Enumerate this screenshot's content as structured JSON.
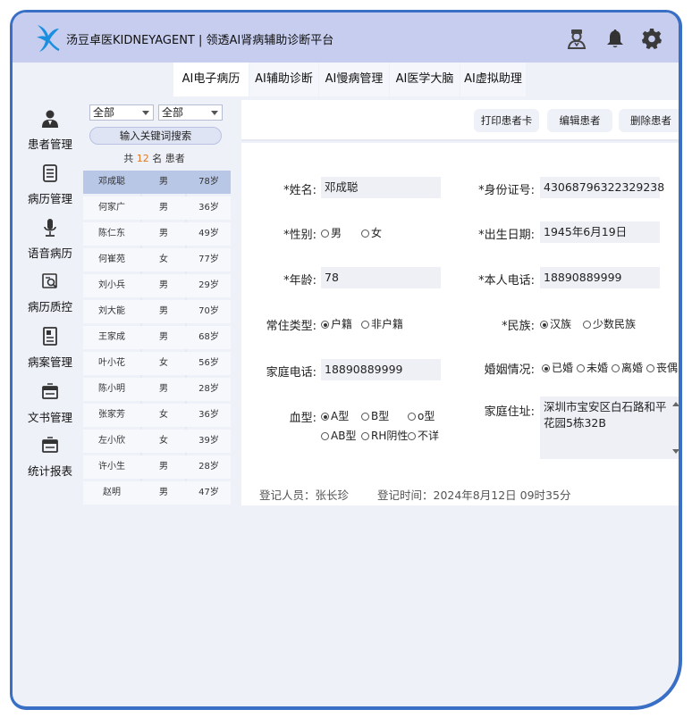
{
  "header": {
    "title": "汤豆卓医KIDNEYAGENT  |  领透AI肾病辅助诊断平台",
    "icons": [
      "doctor-icon",
      "bell-icon",
      "gear-icon"
    ]
  },
  "tabs": [
    {
      "label": "AI电子病历",
      "active": true
    },
    {
      "label": "AI辅助诊断",
      "active": false
    },
    {
      "label": "AI慢病管理",
      "active": false
    },
    {
      "label": "AI医学大脑",
      "active": false
    },
    {
      "label": "AI虚拟助理",
      "active": false
    }
  ],
  "sidenav": [
    {
      "label": "患者管理",
      "icon": "user-icon"
    },
    {
      "label": "病历管理",
      "icon": "document-icon"
    },
    {
      "label": "语音病历",
      "icon": "microphone-icon"
    },
    {
      "label": "病历质控",
      "icon": "inspect-icon"
    },
    {
      "label": "病案管理",
      "icon": "file-icon"
    },
    {
      "label": "文书管理",
      "icon": "folder-icon"
    },
    {
      "label": "统计报表",
      "icon": "report-icon"
    }
  ],
  "filters": {
    "select1": "全部",
    "select2": "全部",
    "search_label": "输入关键词搜索"
  },
  "count": {
    "prefix": "共 ",
    "number": "12",
    "suffix": " 名 患者"
  },
  "patients": [
    {
      "name": "邓成聪",
      "sex": "男",
      "age": "78岁",
      "selected": true
    },
    {
      "name": "何家广",
      "sex": "男",
      "age": "36岁"
    },
    {
      "name": "陈仁东",
      "sex": "男",
      "age": "49岁"
    },
    {
      "name": "何崔苑",
      "sex": "女",
      "age": "77岁"
    },
    {
      "name": "刘小兵",
      "sex": "男",
      "age": "29岁"
    },
    {
      "name": "刘大能",
      "sex": "男",
      "age": "70岁"
    },
    {
      "name": "王家成",
      "sex": "男",
      "age": "68岁"
    },
    {
      "name": "叶小花",
      "sex": "女",
      "age": "56岁"
    },
    {
      "name": "陈小明",
      "sex": "男",
      "age": "28岁"
    },
    {
      "name": "张家芳",
      "sex": "女",
      "age": "36岁"
    },
    {
      "name": "左小欣",
      "sex": "女",
      "age": "39岁"
    },
    {
      "name": "许小生",
      "sex": "男",
      "age": "28岁"
    },
    {
      "name": "赵明",
      "sex": "男",
      "age": "47岁"
    }
  ],
  "actions": {
    "print": "打印患者卡",
    "edit": "编辑患者",
    "delete": "删除患者"
  },
  "form": {
    "name_label": "*姓名:",
    "name": "邓成聪",
    "id_label": "*身份证号:",
    "id": "43068796322329238",
    "sex_label": "*性别:",
    "sex_male": "男",
    "sex_female": "女",
    "dob_label": "*出生日期:",
    "dob": "1945年6月19日",
    "age_label": "*年龄:",
    "age": "78",
    "phone_label": "*本人电话:",
    "phone": "18890889999",
    "residence_label": "常住类型:",
    "res_local": "户籍",
    "res_nonlocal": "非户籍",
    "ethnic_label": "*民族:",
    "eth_han": "汉族",
    "eth_minor": "少数民族",
    "home_phone_label": "家庭电话:",
    "home_phone": "18890889999",
    "marital_label": "婚姻情况:",
    "mar_married": "已婚",
    "mar_single": "未婚",
    "mar_divorced": "离婚",
    "mar_widowed": "丧偶",
    "blood_label": "血型:",
    "blood_a": "A型",
    "blood_b": "B型",
    "blood_o": "o型",
    "blood_ab": "AB型",
    "blood_rh": "RH阴性",
    "blood_unknown": "不详",
    "address_label": "家庭住址:",
    "address": "深圳市宝安区白石路和平花园5栋32B",
    "registrar": "登记人员：张长珍",
    "reg_time": "登记时间：2024年8月12日  09时35分"
  }
}
